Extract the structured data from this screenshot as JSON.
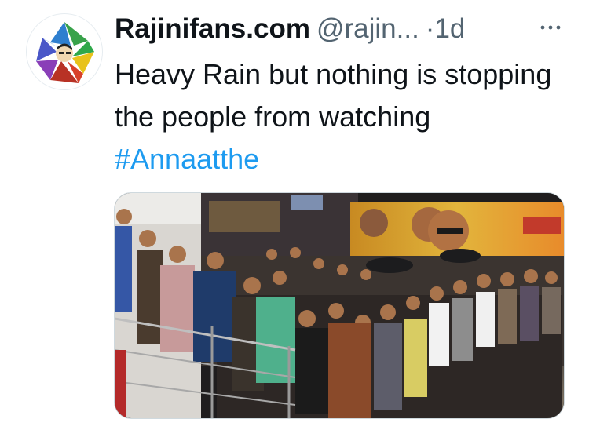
{
  "tweet": {
    "display_name": "Rajinifans.com",
    "handle": "@rajin...",
    "separator": "·",
    "time": "1d",
    "text_prefix": "Heavy Rain but nothing is stopping the people from watching ",
    "hashtag": "#Annaatthe"
  },
  "icons": {
    "avatar": "star-logo-icon",
    "more": "more-horizontal-icon"
  },
  "colors": {
    "hashtag": "#1d9bf0",
    "meta_text": "#536471",
    "body_text": "#0f1419"
  }
}
